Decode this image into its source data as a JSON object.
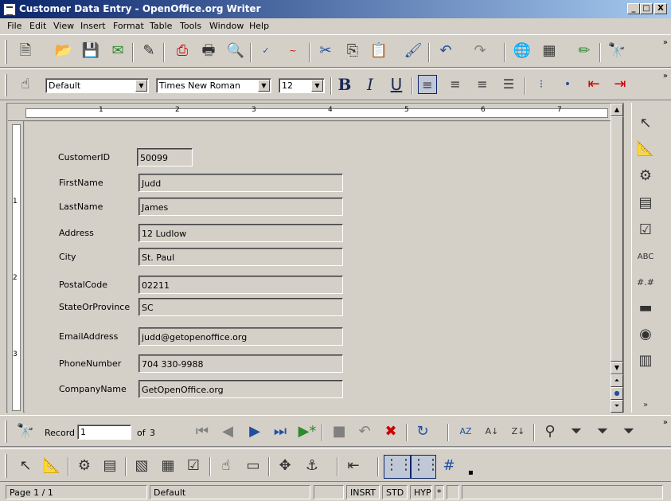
{
  "window": {
    "title": "Customer Data Entry - OpenOffice.org Writer",
    "minimize": "_",
    "maximize": "□",
    "close": "X"
  },
  "menu": [
    "File",
    "Edit",
    "View",
    "Insert",
    "Format",
    "Table",
    "Tools",
    "Window",
    "Help"
  ],
  "format_toolbar": {
    "style": "Default",
    "font": "Times New Roman",
    "size": "12",
    "bold": "B",
    "italic": "I",
    "underline": "U"
  },
  "ruler": {
    "marks": [
      "1",
      "2",
      "3",
      "4",
      "5",
      "6",
      "7"
    ],
    "vmarks": [
      "1",
      "2",
      "3"
    ]
  },
  "form": {
    "fields": [
      {
        "label": "CustomerID",
        "value": "50099"
      },
      {
        "label": "FirstName",
        "value": "Judd"
      },
      {
        "label": "LastName",
        "value": "James"
      },
      {
        "label": "Address",
        "value": "12 Ludlow"
      },
      {
        "label": "City",
        "value": "St. Paul"
      },
      {
        "label": "PostalCode",
        "value": "02211"
      },
      {
        "label": "StateOrProvince",
        "value": "SC"
      },
      {
        "label": "EmailAddress",
        "value": "judd@getopenoffice.org"
      },
      {
        "label": "PhoneNumber",
        "value": "704 330-9988"
      },
      {
        "label": "CompanyName",
        "value": "GetOpenOffice.org"
      }
    ]
  },
  "navigation": {
    "record_label": "Record",
    "record_value": "1",
    "of_label": "of",
    "total": "3"
  },
  "status": {
    "page": "Page 1 / 1",
    "style": "Default",
    "insert_mode": "INSRT",
    "selection_mode": "STD",
    "hyperlink_mode": "HYP",
    "modified": "*"
  },
  "colors": {
    "titlebar_start": "#0a246a",
    "titlebar_end": "#a6caf0",
    "face": "#d4d0c8"
  }
}
